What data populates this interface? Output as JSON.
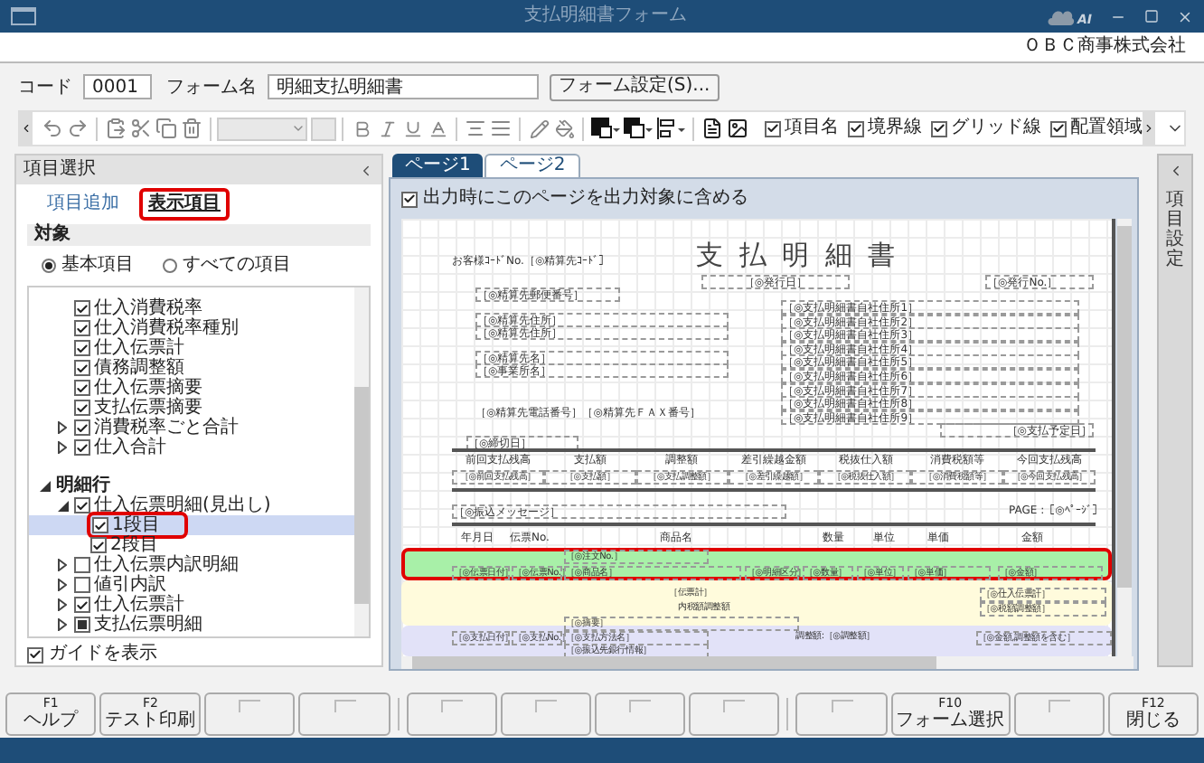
{
  "window": {
    "title": "支払明細書フォーム",
    "badge": "AI"
  },
  "company": "ＯＢＣ商事株式会社",
  "form_info": {
    "code_label": "コード",
    "code": "0001",
    "name_label": "フォーム名",
    "name": "明細支払明細書",
    "settings_button": "フォーム設定(S)..."
  },
  "toolbar": {
    "toggles": [
      {
        "label": "項目名",
        "checked": true
      },
      {
        "label": "境界線",
        "checked": true
      },
      {
        "label": "グリッド線",
        "checked": true
      },
      {
        "label": "配置領域",
        "checked": true
      }
    ]
  },
  "item_selection": {
    "title": "項目選択",
    "tabs": [
      {
        "label": "項目追加",
        "selected": false
      },
      {
        "label": "表示項目",
        "selected": true
      }
    ],
    "section_label": "対象",
    "scope_options": [
      {
        "label": "基本項目",
        "selected": true
      },
      {
        "label": "すべての項目",
        "selected": false
      }
    ],
    "tree": [
      {
        "items": [
          {
            "label": "仕入消費税率",
            "checked": true,
            "indeterminate": false,
            "selected": false
          },
          {
            "label": "仕入消費税率種別",
            "checked": true,
            "indeterminate": false,
            "selected": false
          },
          {
            "label": "仕入伝票計",
            "checked": true,
            "indeterminate": false,
            "selected": false
          },
          {
            "label": "債務調整額",
            "checked": true,
            "indeterminate": false,
            "selected": false
          },
          {
            "label": "仕入伝票摘要",
            "checked": true,
            "indeterminate": false,
            "selected": false
          },
          {
            "label": "支払伝票摘要",
            "checked": true,
            "indeterminate": false,
            "selected": false
          },
          {
            "label": "消費税率ごと合計",
            "checked": true,
            "indeterminate": false,
            "expanded": false,
            "selected": false
          },
          {
            "label": "仕入合計",
            "checked": true,
            "indeterminate": false,
            "expanded": false,
            "selected": false
          }
        ]
      },
      {
        "label": "明細行",
        "expanded": true,
        "items": [
          {
            "label": "仕入伝票明細(見出し)",
            "checked": true,
            "indeterminate": false,
            "expanded": true,
            "selected": false,
            "children": [
              {
                "label": "1段目",
                "checked": true,
                "indeterminate": false,
                "selected": true
              },
              {
                "label": "2段目",
                "checked": true,
                "indeterminate": false,
                "selected": false
              }
            ]
          },
          {
            "label": "仕入伝票内訳明細",
            "checked": false,
            "indeterminate": false,
            "expanded": false,
            "selected": false
          },
          {
            "label": "値引内訳",
            "checked": false,
            "indeterminate": false,
            "expanded": false,
            "selected": false
          },
          {
            "label": "仕入伝票計",
            "checked": true,
            "indeterminate": false,
            "expanded": false,
            "selected": false
          },
          {
            "label": "支払伝票明細",
            "indeterminate": true,
            "expanded": false,
            "selected": false
          }
        ]
      }
    ],
    "show_guides": {
      "label": "ガイドを表示",
      "checked": true
    }
  },
  "pages": {
    "tabs": [
      {
        "label": "ページ1",
        "selected": true
      },
      {
        "label": "ページ2",
        "selected": false
      }
    ],
    "include_in_output": {
      "label": "出力時にこのページを出力対象に含める",
      "checked": true
    },
    "canvas": {
      "title": "支 払 明 細 書",
      "header_items": [
        "お客様ｺｰﾄﾞNo.［◎精算先ｺｰﾄﾞ］",
        "［◎発行日］",
        "［◎発行No.］",
        "［◎精算先郵便番号］",
        "［◎精算先住所］",
        "［◎精算先住所］",
        "［◎精算先名］",
        "［◎事業所名］",
        "［◎精算先電話番号］［◎精算先ＦＡＸ番号］",
        "［◎支払予定日］",
        "［◎締切日］"
      ],
      "company_address_lines": [
        "［◎支払明細書自社住所1］",
        "［◎支払明細書自社住所2］",
        "［◎支払明細書自社住所3］",
        "［◎支払明細書自社住所4］",
        "［◎支払明細書自社住所5］",
        "［◎支払明細書自社住所6］",
        "［◎支払明細書自社住所7］",
        "［◎支払明細書自社住所8］",
        "［◎支払明細書自社住所9］"
      ],
      "summary_columns": [
        {
          "label": "前回支払残高",
          "field": "［◎前回支払残高］"
        },
        {
          "label": "支払額",
          "field": "［◎支払額］"
        },
        {
          "label": "調整額",
          "field": "［◎支払調整額］"
        },
        {
          "label": "差引繰越金額",
          "field": "［◎差引繰越額］"
        },
        {
          "label": "税抜仕入額",
          "field": "［◎税抜仕入額］"
        },
        {
          "label": "消費税額等",
          "field": "［◎消費税額等］"
        },
        {
          "label": "今回支払残高",
          "field": "［◎今回支払残高］"
        }
      ],
      "message": "［◎振込メッセージ］",
      "page": "PAGE :［◎ﾍﾟｰｼﾞ］",
      "detail_headers": [
        "年月日",
        "伝票No.",
        "商品名",
        "数量",
        "単位",
        "単価",
        "金額"
      ],
      "bands": [
        {
          "kind": "detail",
          "selected": true,
          "items": [
            "［◎注文No.］",
            "［◎伝票日付］",
            "［◎伝票No.］",
            "［◎商品名］",
            "［◎明細区分］",
            "［◎数量］",
            "［◎単位］",
            "［◎単価］",
            "［◎金額］"
          ]
        },
        {
          "kind": "total",
          "selected": false,
          "items": [
            "［伝票計］",
            "内税額調整額",
            "［◎仕入伝票計］",
            "［◎税額調整額］"
          ]
        },
        {
          "kind": "payment",
          "selected": false,
          "items": [
            "［◎摘要］",
            "［◎支払日付］",
            "［◎支払No.］",
            "［◎支払方法名］",
            "調整額:［◎調整額］",
            "［◎金額,調整額を含む］",
            "［◎振込先銀行情報］"
          ]
        }
      ]
    }
  },
  "item_settings": {
    "title": "項目設定"
  },
  "function_keys": [
    {
      "kind": "assigned",
      "key": "F1",
      "label": "ヘルプ"
    },
    {
      "kind": "assigned",
      "key": "F2",
      "label": "テスト印刷"
    },
    {
      "kind": "blank"
    },
    {
      "kind": "blank"
    },
    {
      "kind": "blank"
    },
    {
      "kind": "blank"
    },
    {
      "kind": "blank"
    },
    {
      "kind": "blank"
    },
    {
      "kind": "blank"
    },
    {
      "kind": "assigned",
      "key": "F10",
      "label": "フォーム選択"
    },
    {
      "kind": "blank"
    },
    {
      "kind": "assigned",
      "key": "F12",
      "label": "閉じる"
    }
  ]
}
